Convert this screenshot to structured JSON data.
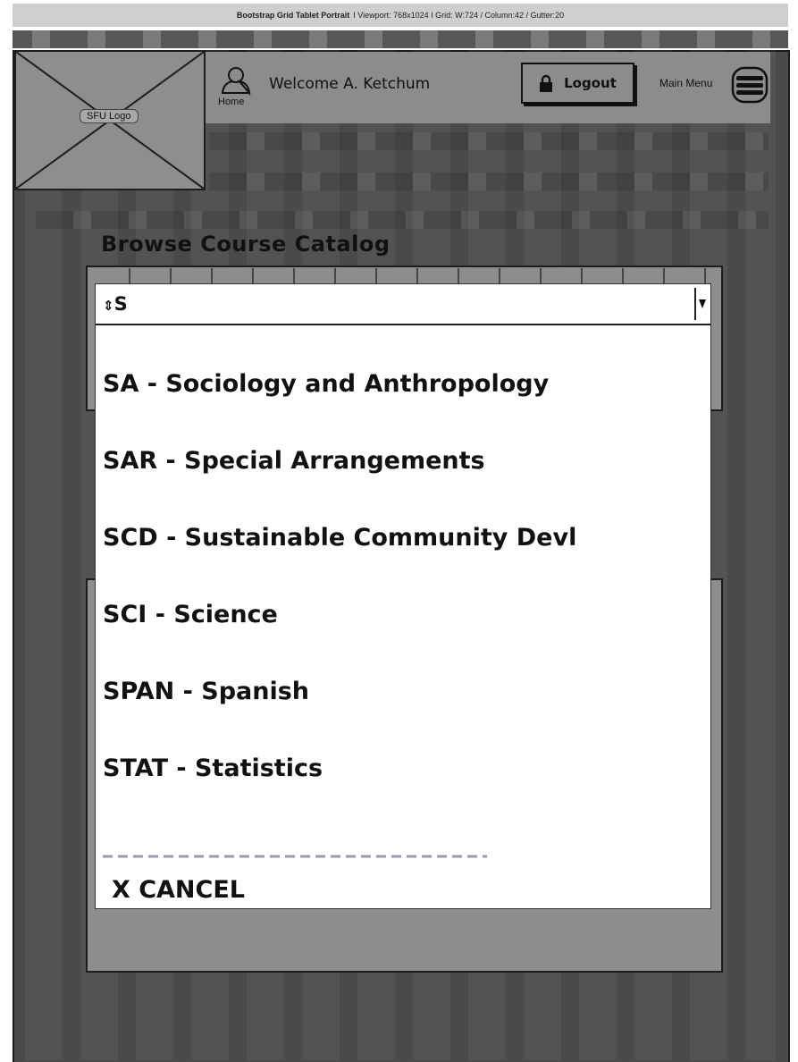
{
  "annotation": {
    "title": "Bootstrap Grid Tablet Portrait",
    "details": "Viewport: 768x1024  I  Grid: W:724 / Column:42 / Gutter:20"
  },
  "header": {
    "logo_label": "SFU Logo",
    "home_label": "Home",
    "welcome_text": "Welcome A. Ketchum",
    "logout_label": "Logout",
    "main_menu_label": "Main Menu"
  },
  "page": {
    "title": "Browse Course Catalog"
  },
  "dropdown": {
    "selected_value": "S",
    "options": [
      "SA - Sociology and Anthropology",
      "SAR - Special Arrangements",
      "SCD - Sustainable Community Devl",
      "SCI - Science",
      "SPAN - Spanish",
      "STAT - Statistics"
    ],
    "cancel_label": "X  CANCEL"
  },
  "colors": {
    "background": "#4a4a4a",
    "panel": "#8d8d8d",
    "header": "#8c8c8c",
    "dropdown": "#ffffff",
    "text": "#111111"
  }
}
